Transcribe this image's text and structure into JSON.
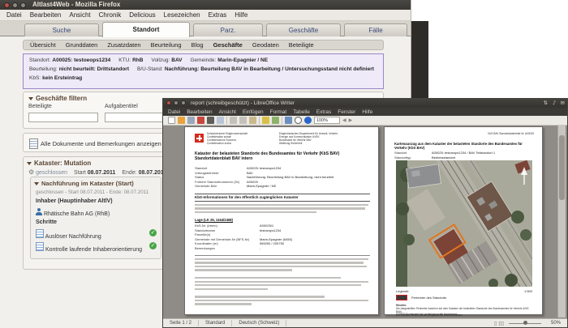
{
  "colors": {
    "accent_purple": "#9a86c8",
    "check_green": "#46a546",
    "swiss_red": "#d52b1e",
    "perimeter_orange": "#e2761f",
    "titlebar_dark": "#3c3a36"
  },
  "ff": {
    "title": "Altlast4Web - Mozilla Firefox",
    "menu": [
      "Datei",
      "Bearbeiten",
      "Ansicht",
      "Chronik",
      "Delicious",
      "Lesezeichen",
      "Extras",
      "Hilfe"
    ],
    "tabs": [
      {
        "label": "Suche",
        "active": false
      },
      {
        "label": "Standort",
        "active": true
      },
      {
        "label": "Parz.",
        "active": false
      },
      {
        "label": "Geschäfte",
        "active": false
      },
      {
        "label": "Fälle",
        "active": false
      }
    ],
    "subtabs": [
      "Übersicht",
      "Grunddaten",
      "Zusatzdaten",
      "Beurteilung",
      "Blog",
      "Geschäfte",
      "Geodaten",
      "Beteiligte"
    ],
    "active_subtab": "Geschäfte",
    "infobox": {
      "line1": [
        {
          "l": "Standort:",
          "v": "A00025: testoeops1234"
        },
        {
          "l": "KTU:",
          "v": "RhB"
        },
        {
          "l": "Vollzug:",
          "v": "BAV"
        },
        {
          "l": "Gemeinde:",
          "v": "Marin-Epagnier / NE"
        }
      ],
      "line2": [
        {
          "l": "Beurteilung:",
          "v": "nicht beurteilt: Drittstandort"
        },
        {
          "l": "B/U-Stand:",
          "v": "Nachführung: Beurteilung BAV in Bearbeitung / Untersuchungsstand nicht definiert"
        }
      ],
      "line3": [
        {
          "l": "KbS:",
          "v": "kein Ersteintrag"
        }
      ]
    },
    "filter": {
      "title": "Geschäfte filtern",
      "field1": "Beteiligte",
      "field2": "Aufgabentitel"
    },
    "docs_link": "Alle Dokumente und Bemerkungen anzeigen",
    "kataster": {
      "title": "Kataster: Mutation",
      "status": "geschlossen",
      "start_label": "Start",
      "start": "08.07.2011",
      "end_label": "Ende:",
      "end": "08.07.2011"
    },
    "nachf": {
      "title": "Nachführung im Kataster (Start)",
      "status": "geschlossen - Start 08.07.2011 - Ende: 08.07.2011",
      "inhaber_label": "Inhaber (Hauptinhaber AltlV)",
      "inhaber": "Rhätische Bahn AG (RhB)",
      "schritte_label": "Schritte",
      "steps": [
        "Auslöser Nachführung",
        "Kontrolle laufende Inhaberorientierung"
      ]
    }
  },
  "lo": {
    "title": "report (schreibgeschützt) - LibreOffice Writer",
    "menu": [
      "Datei",
      "Bearbeiten",
      "Ansicht",
      "Einfügen",
      "Format",
      "Tabelle",
      "Extras",
      "Fenster",
      "Hilfe"
    ],
    "toolbar": {
      "zoom": "100%"
    },
    "page1": {
      "confed": [
        "Schweizerische Eidgenossenschaft",
        "Confédération suisse",
        "Confederazione Svizzera",
        "Confederaziun svizra"
      ],
      "dept": [
        "Eidgenössisches Departement für Umwelt, Verkehr,",
        "Energie und Kommunikation UVEK",
        "Bundesamt für Verkehr BAV",
        "Abteilung Sicherheit"
      ],
      "title1": "Kataster der belasteten Standorte des Bundesamtes für Verkehr (KbS BAV)",
      "title2": "Standortdatenblatt BAV intern",
      "rowsA": [
        {
          "l": "Standort",
          "v": "A00025: testoeops1234"
        },
        {
          "l": "Vollzugsbehörde",
          "v": "BAV"
        },
        {
          "l": "Status",
          "v": "Nachführung: Beurteilung BAV in Bearbeitung, nicht beurteilt"
        },
        {
          "l": "Frühere Standortnummern (Dt)",
          "v": "A00025"
        },
        {
          "l": "Gemeinde BAV",
          "v": "Marin-Epagnier / NE"
        }
      ],
      "headingA": "KbS-Informationen für den öffentlich zugänglichen Kataster",
      "subheadB": "Lage (LK 25, 1164/2458)",
      "rowsB": [
        {
          "l": "KbS-Nr. (intern)",
          "v": "A00025/1"
        },
        {
          "l": "Standortname",
          "v": "testoeops1234"
        },
        {
          "l": "Parzelle(n)",
          "v": "-"
        },
        {
          "l": "Gemeinde mit Gemeinde-Nr (BFS-Nr)",
          "v": "Marin-Epagnier (6455)"
        },
        {
          "l": "Koordinaten (m)",
          "v": "565250 / 205750"
        },
        {
          "l": "Bemerkungen",
          "v": "-"
        }
      ]
    },
    "page2": {
      "header_right": "KbS BAV Standortdatenblatt Nr. A00025",
      "title": "Kartenauszug aus dem Kataster der belasteten Standorte des Bundesamtes für Verkehr (KbS BAV)",
      "rows": [
        {
          "l": "Standort",
          "v": "A00025: testoeops1234 / BAV Teilstandort 1"
        },
        {
          "l": "Standorttyp",
          "v": "Betriebsstandort"
        }
      ],
      "legende_label": "Legende",
      "scale": "1:500",
      "legend_item": "Perimeter des Standorts",
      "hinweis_label": "Hinweis:",
      "hinweis1": "Die dargestellten Perimeter basieren auf dem Kataster der belasteten Standorte des Bundesamtes für Verkehr (KbS BAV).",
      "hinweis2": "Der Kataster beruht auf den Angaben der Standortinhaber.",
      "copyright": "© PK25 Bundesamt für Landestopografie (swisstopo)"
    },
    "status": {
      "page": "Seite 1 / 2",
      "style": "Standard",
      "lang": "Deutsch (Schweiz)",
      "zoom": "50%"
    }
  }
}
